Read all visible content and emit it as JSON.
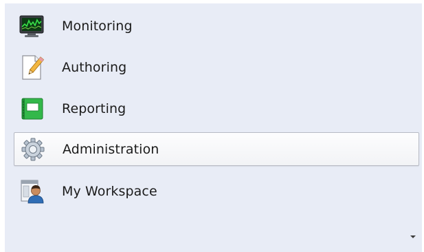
{
  "nav": {
    "items": [
      {
        "label": "Monitoring",
        "icon": "monitor-icon"
      },
      {
        "label": "Authoring",
        "icon": "document-pencil-icon"
      },
      {
        "label": "Reporting",
        "icon": "report-book-icon"
      },
      {
        "label": "Administration",
        "icon": "gear-icon",
        "selected": true
      },
      {
        "label": "My Workspace",
        "icon": "user-workspace-icon"
      }
    ],
    "overflow_icon": "chevron-down-icon"
  },
  "colors": {
    "panel_bg": "#e8ecf6",
    "selected_border": "#b7bac4",
    "text": "#1b1b1b"
  }
}
